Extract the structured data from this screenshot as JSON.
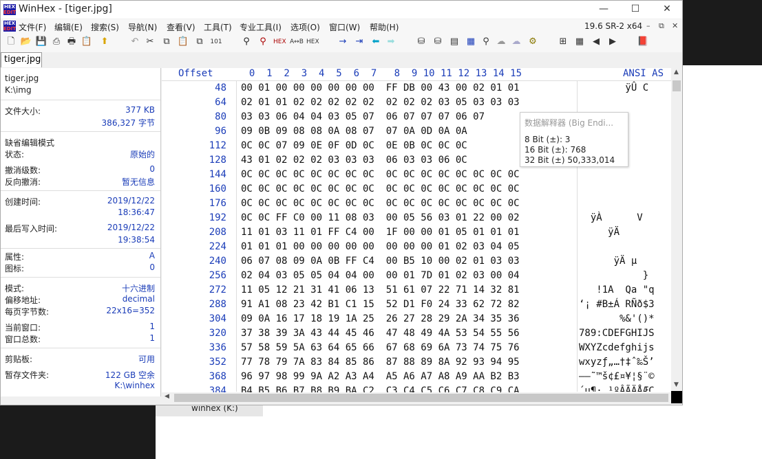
{
  "window": {
    "title": "WinHex - [tiger.jpg]",
    "version": "19.6 SR-2 x64",
    "minimize": "—",
    "maximize": "☐",
    "close": "✕"
  },
  "menus": [
    "文件(F)",
    "编辑(E)",
    "搜索(S)",
    "导航(N)",
    "查看(V)",
    "工具(T)",
    "专业工具(I)",
    "选项(O)",
    "窗口(W)",
    "帮助(H)"
  ],
  "tab": {
    "label": "tiger.jpg"
  },
  "info": {
    "file_name": "tiger.jpg",
    "path": "K:\\img",
    "size_label": "文件大小:",
    "size_kb": "377 KB",
    "size_bytes": "386,327 字节",
    "edit_mode_label": "缺省编辑模式",
    "state_label": "状态:",
    "state_value": "原始的",
    "undo_label": "撤消级数:",
    "undo_value": "0",
    "redo_label": "反向撤消:",
    "redo_value": "暂无信息",
    "created_label": "创建时间:",
    "created_date": "2019/12/22",
    "created_time": "18:36:47",
    "modified_label": "最后写入时间:",
    "modified_date": "2019/12/22",
    "modified_time": "19:38:54",
    "attr_label": "属性:",
    "attr_value": "A",
    "icon_label": "图标:",
    "icon_value": "0",
    "mode_label": "模式:",
    "mode_value": "十六进制",
    "offset_label": "偏移地址:",
    "offset_value": "decimal",
    "bpp_label": "每页字节数:",
    "bpp_value": "22x16=352",
    "curwin_label": "当前窗口:",
    "curwin_value": "1",
    "totalwin_label": "窗口总数:",
    "totalwin_value": "1",
    "clip_label": "剪贴板:",
    "clip_value": "可用",
    "temp_label": "暂存文件夹:",
    "temp_value": "122 GB 空余",
    "temp_path": "K:\\winhex"
  },
  "hex": {
    "offset_header": "Offset",
    "col_headers": "  0  1  2  3  4  5  6  7   8  9 10 11 12 13 14 15",
    "ansi_header": "ANSI AS",
    "rows": [
      {
        "off": "48",
        "bytes": "00 01 00 00 00 00 00 00  FF DB 00 43 00 02 01 01",
        "ascii": "        ÿÛ C"
      },
      {
        "off": "64",
        "bytes": "02 01 01 02 02 02 02 02  02 02 02 03 05 03 03 03",
        "ascii": ""
      },
      {
        "off": "80",
        "bytes": "03 03 06 04 04 03 05 07  06 07 07 07 06 07",
        "ascii": ""
      },
      {
        "off": "96",
        "bytes": "09 0B 09 08 08 0A 08 07  07 0A 0D 0A 0A",
        "ascii": ""
      },
      {
        "off": "112",
        "bytes": "0C 0C 07 09 0E 0F 0D 0C  0E 0B 0C 0C 0C",
        "ascii": ""
      },
      {
        "off": "128",
        "bytes": "43 01 02 02 02 03 03 03  06 03 03 06 0C",
        "ascii": ""
      },
      {
        "off": "144",
        "bytes": "0C 0C 0C 0C 0C 0C 0C 0C  0C 0C 0C 0C 0C 0C 0C 0C",
        "ascii": ""
      },
      {
        "off": "160",
        "bytes": "0C 0C 0C 0C 0C 0C 0C 0C  0C 0C 0C 0C 0C 0C 0C 0C",
        "ascii": ""
      },
      {
        "off": "176",
        "bytes": "0C 0C 0C 0C 0C 0C 0C 0C  0C 0C 0C 0C 0C 0C 0C 0C",
        "ascii": ""
      },
      {
        "off": "192",
        "bytes": "0C 0C FF C0 00 11 08 03  00 05 56 03 01 22 00 02",
        "ascii": "  ÿÀ      V"
      },
      {
        "off": "208",
        "bytes": "11 01 03 11 01 FF C4 00  1F 00 00 01 05 01 01 01",
        "ascii": "     ÿÄ"
      },
      {
        "off": "224",
        "bytes": "01 01 01 00 00 00 00 00  00 00 00 01 02 03 04 05",
        "ascii": ""
      },
      {
        "off": "240",
        "bytes": "06 07 08 09 0A 0B FF C4  00 B5 10 00 02 01 03 03",
        "ascii": "      ÿÄ µ"
      },
      {
        "off": "256",
        "bytes": "02 04 03 05 05 04 04 00  00 01 7D 01 02 03 00 04",
        "ascii": "           }"
      },
      {
        "off": "272",
        "bytes": "11 05 12 21 31 41 06 13  51 61 07 22 71 14 32 81",
        "ascii": "   !1A  Qa \"q"
      },
      {
        "off": "288",
        "bytes": "91 A1 08 23 42 B1 C1 15  52 D1 F0 24 33 62 72 82",
        "ascii": "‘¡ #B±Á RÑð$3"
      },
      {
        "off": "304",
        "bytes": "09 0A 16 17 18 19 1A 25  26 27 28 29 2A 34 35 36",
        "ascii": "       %&'()*"
      },
      {
        "off": "320",
        "bytes": "37 38 39 3A 43 44 45 46  47 48 49 4A 53 54 55 56",
        "ascii": "789:CDEFGHIJS"
      },
      {
        "off": "336",
        "bytes": "57 58 59 5A 63 64 65 66  67 68 69 6A 73 74 75 76",
        "ascii": "WXYZcdefghijs"
      },
      {
        "off": "352",
        "bytes": "77 78 79 7A 83 84 85 86  87 88 89 8A 92 93 94 95",
        "ascii": "wxyzƒ„…†‡ˆ‰Š’"
      },
      {
        "off": "368",
        "bytes": "96 97 98 99 9A A2 A3 A4  A5 A6 A7 A8 A9 AA B2 B3",
        "ascii": "–—˜™š¢£¤¥¦§¨©"
      },
      {
        "off": "384",
        "bytes": "B4 B5 B6 B7 B8 B9 BA C2  C3 C4 C5 C6 C7 C8 C9 CA",
        "ascii": "´µ¶·¸¹ºÂÃÄÅÆÇ"
      }
    ]
  },
  "tooltip": {
    "header": "数据解释器 (Big Endi...",
    "bit8": "8 Bit (±): 3",
    "bit16": "16 Bit (±): 768",
    "bit32": "32 Bit (±) 50,333,014"
  },
  "taskbar": {
    "item": "winhex (K:)"
  }
}
